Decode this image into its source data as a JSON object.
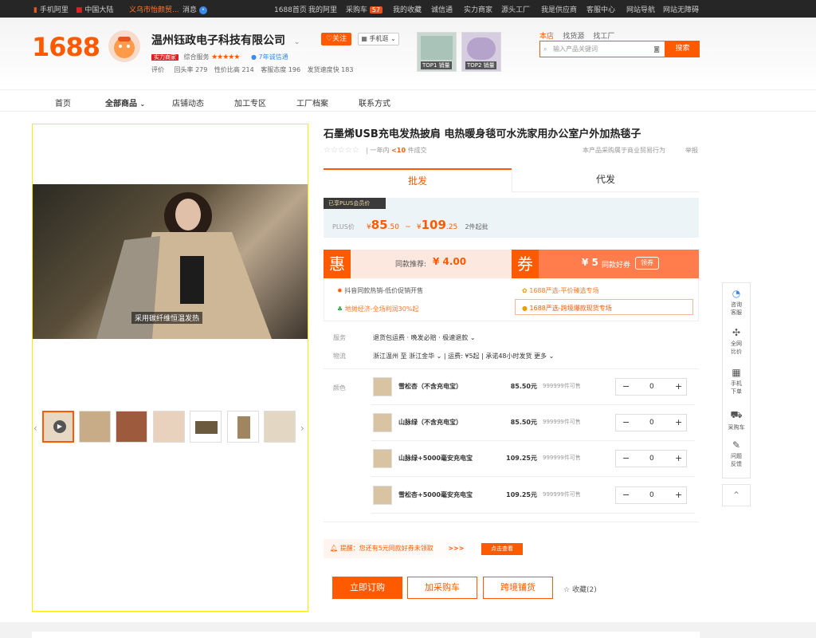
{
  "topbar": {
    "home": "手机阿里",
    "region": "中国大陆",
    "market": "义乌市怡颜贸...",
    "message": "消息",
    "home_link": "1688首页",
    "my_ali": "我的阿里",
    "cart": "采购车",
    "cart_count": "57",
    "favorites": "我的收藏",
    "trust": "诚信通",
    "merchants": "实力商家",
    "source_factory": "源头工厂",
    "supplier": "我是供应商",
    "service": "客服中心",
    "site_nav": "网站导航",
    "accessible": "网站无障碍"
  },
  "header": {
    "logo": "1688",
    "shop_name": "温州钰政电子科技有限公司",
    "follow": "关注",
    "mobile": "手机逛",
    "badge": "实力商家",
    "composite": "综合服务",
    "stars": "★★★★★",
    "trust_years": "7年诚信通",
    "review_label": "评价",
    "metrics": [
      "回头率 279",
      "性价比高 214",
      "客服态度 196",
      "发货速度快 183"
    ],
    "top1": "TOP1 销量",
    "top2": "TOP2 销量",
    "search_tabs": [
      "本店",
      "找货源",
      "找工厂"
    ],
    "search_placeholder": "输入产品关键词",
    "search_btn": "搜索"
  },
  "nav": [
    "首页",
    "全部商品",
    "店铺动态",
    "加工专区",
    "工厂档案",
    "联系方式"
  ],
  "video": {
    "caption": "采用碳纤维恒温发热"
  },
  "product": {
    "title": "石墨烯USB充电发热披肩 电热暖身毯可水洗家用办公室户外加热毯子",
    "stars": "☆☆☆☆☆",
    "sales_prefix": "一年内",
    "sales_value": "<10",
    "sales_suffix": "件成交",
    "notice": "本产品采购属于商业贸易行为",
    "report": "举报"
  },
  "tabs": {
    "pifa": "批发",
    "daifa": "代发"
  },
  "price": {
    "plus_badge": "已享PLUS会员价",
    "plus_label": "PLUS价",
    "low_int": "85",
    "low_dec": ".50",
    "high_int": "109",
    "high_dec": ".25",
    "sep": "~",
    "currency": "¥",
    "moq": "2件起批"
  },
  "coupon": {
    "hui": "惠",
    "same_label": "同款推荐:",
    "same_value": "¥ 4.00",
    "quan": "券",
    "good_value": "¥ 5",
    "good_label": "同款好券",
    "get": "领券"
  },
  "promos": [
    "抖音同款热销-低价促销开售",
    "1688严选-平价臻选专场",
    "地摊经济-全场利润30%起",
    "1688严选-跨境爆款现货专场"
  ],
  "service": {
    "service_label": "服务",
    "service_value": "退货包运费 · 晚发必赔 · 极速退款",
    "logistics_label": "物流",
    "route": "浙江温州 至 浙江金华",
    "fee": "运费: ¥5起",
    "eta": "承诺48小时发货",
    "more": "更多",
    "color_label": "颜色"
  },
  "skus": [
    {
      "name": "雪松杏（不含充电宝）",
      "price": "85.50元",
      "stock": "999999件可售",
      "qty": "0"
    },
    {
      "name": "山脉绿（不含充电宝）",
      "price": "85.50元",
      "stock": "999999件可售",
      "qty": "0"
    },
    {
      "name": "山脉绿+5000毫安充电宝",
      "price": "109.25元",
      "stock": "999999件可售",
      "qty": "0"
    },
    {
      "name": "雪松杏+5000毫安充电宝",
      "price": "109.25元",
      "stock": "999999件可售",
      "qty": "0"
    }
  ],
  "reminder": {
    "text": "提醒：您还有5元同款好券未领取",
    "arrows": ">>>",
    "look": "点击查看"
  },
  "actions": {
    "order": "立即订购",
    "cart": "加采购车",
    "shop": "跨境铺货",
    "fav": "收藏(2)"
  },
  "toolbar": [
    "咨询客服",
    "全网比价",
    "手机下单",
    "采购车",
    "问题反馈"
  ],
  "colors": {
    "accent": "#ff5a00"
  }
}
